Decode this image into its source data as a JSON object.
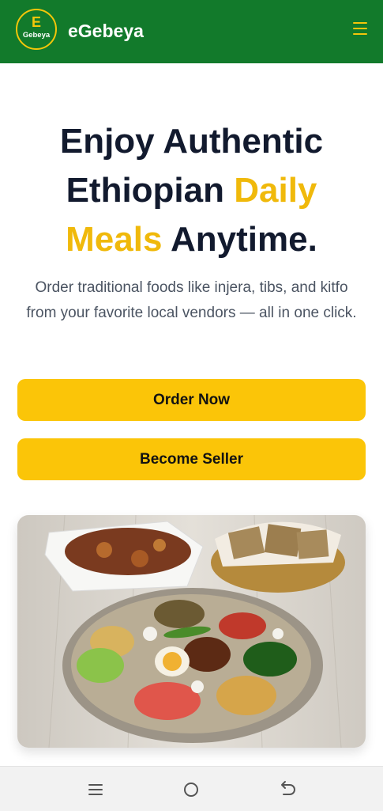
{
  "header": {
    "logo_letter": "E",
    "logo_text": "Gebeya",
    "brand": "eGebeya",
    "menu_icon": "hamburger-menu-icon"
  },
  "hero": {
    "title_line1": "Enjoy Authentic",
    "title_line2_a": "Ethiopian ",
    "title_line2_b": "Daily",
    "title_line3_a": "Meals",
    "title_line3_b": " Anytime.",
    "subtitle": "Order traditional foods like injera, tibs, and kitfo from your favorite local vendors — all in one click."
  },
  "buttons": {
    "order": "Order Now",
    "seller": "Become Seller"
  },
  "colors": {
    "header_bg": "#127a2b",
    "accent": "#f0b90b",
    "button_bg": "#fbc508",
    "title_text": "#121a2e"
  },
  "system_nav": {
    "recent_icon": "recent-apps-icon",
    "home_icon": "home-circle-icon",
    "back_icon": "back-arrow-icon"
  }
}
